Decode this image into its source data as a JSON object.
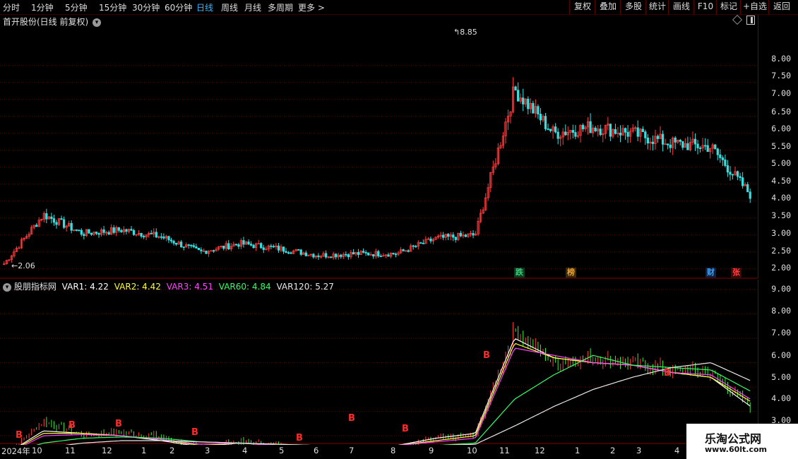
{
  "toolbar": {
    "periods": [
      "分时",
      "1分钟",
      "5分钟",
      "15分钟",
      "30分钟",
      "60分钟",
      "日线",
      "周线",
      "月线",
      "多周期",
      "更多 >"
    ],
    "active_period": "日线",
    "buttons": [
      "复权",
      "叠加",
      "多股",
      "统计",
      "画线",
      "F10",
      "标记",
      "+自选",
      "返回"
    ]
  },
  "main_chart": {
    "title": "首开股份(日线 前复权)",
    "high_label": "8.85",
    "low_label": "2.06",
    "y_ticks": [
      "8.00",
      "7.50",
      "7.00",
      "6.50",
      "6.00",
      "5.50",
      "5.00",
      "4.50",
      "4.00",
      "3.50",
      "3.00",
      "2.50",
      "2.00"
    ],
    "tags": [
      {
        "text": "跌",
        "color": "#33d17a"
      },
      {
        "text": "榜",
        "color": "#f0a030"
      },
      {
        "text": "财",
        "color": "#3ba0ff"
      },
      {
        "text": "张",
        "color": "#ff4040"
      }
    ]
  },
  "indicator": {
    "name": "股朋指标网",
    "items": [
      {
        "label": "VAR1: 4.22",
        "color": "#ffffff"
      },
      {
        "label": "VAR2: 4.42",
        "color": "#ffff33"
      },
      {
        "label": "VAR3: 4.51",
        "color": "#ff44ff"
      },
      {
        "label": "VAR60: 4.84",
        "color": "#33ff66"
      },
      {
        "label": "VAR120: 5.27",
        "color": "#e8e8e8"
      }
    ],
    "y_ticks": [
      "9.00",
      "8.00",
      "7.00",
      "6.00",
      "5.00",
      "4.00",
      "3.00"
    ],
    "signal_text": "B"
  },
  "x_axis": [
    "2024年",
    "10",
    "11",
    "12",
    "1",
    "2",
    "3",
    "4",
    "5",
    "6",
    "7",
    "8",
    "9",
    "10",
    "11",
    "12",
    "1",
    "2",
    "3",
    "4"
  ],
  "watermark": {
    "title": "乐淘公式网",
    "url": "www.60lt.com"
  },
  "colors": {
    "up": "#ff3b3b",
    "down": "#33e0e0",
    "grid": "#5a0000",
    "border": "#8a0000",
    "active": "#33b5ff"
  },
  "chart_data": [
    {
      "type": "candlestick",
      "title": "首开股份(日线 前复权)",
      "ylim": [
        1.85,
        9.1
      ],
      "x": [
        "2024-09",
        "2024-10",
        "2024-11",
        "2024-12",
        "2025-01",
        "2025-02",
        "2025-03",
        "2025-04",
        "2025-05",
        "2025-06",
        "2025-07",
        "2025-08",
        "2025-09",
        "2025-10",
        "2025-11",
        "2025-12",
        "2026-01",
        "2026-02",
        "2026-03",
        "2026-04"
      ],
      "series": [
        {
          "values": [
            2.15,
            3.6,
            3.05,
            3.15,
            2.95,
            2.5,
            2.75,
            2.6,
            2.4,
            2.45,
            2.45,
            2.9,
            3.0,
            7.3,
            6.0,
            6.2,
            6.0,
            5.7,
            5.6,
            4.2
          ]
        }
      ],
      "annotations": [
        {
          "text": "8.85",
          "y": 8.85
        },
        {
          "text": "2.06",
          "y": 2.06
        }
      ]
    },
    {
      "type": "line",
      "ylim": [
        2.8,
        9.35
      ],
      "x": [
        "2024-09",
        "2024-10",
        "2024-11",
        "2024-12",
        "2025-01",
        "2025-02",
        "2025-03",
        "2025-04",
        "2025-05",
        "2025-06",
        "2025-07",
        "2025-08",
        "2025-09",
        "2025-10",
        "2025-11",
        "2025-12",
        "2026-01",
        "2026-02",
        "2026-03",
        "2026-04"
      ],
      "series": [
        {
          "name": "VAR1",
          "values": [
            2.2,
            3.2,
            3.1,
            3.0,
            2.8,
            2.55,
            2.7,
            2.6,
            2.5,
            2.5,
            2.6,
            2.9,
            3.1,
            7.0,
            6.2,
            6.0,
            5.9,
            5.6,
            5.4,
            4.22
          ]
        },
        {
          "name": "VAR2",
          "values": [
            2.2,
            3.1,
            3.1,
            3.0,
            2.85,
            2.6,
            2.7,
            2.6,
            2.5,
            2.5,
            2.6,
            2.8,
            3.0,
            6.8,
            6.2,
            6.0,
            5.9,
            5.6,
            5.4,
            4.42
          ]
        },
        {
          "name": "VAR3",
          "values": [
            2.2,
            3.0,
            3.05,
            3.0,
            2.85,
            2.65,
            2.7,
            2.6,
            2.55,
            2.5,
            2.6,
            2.75,
            2.9,
            6.6,
            6.3,
            6.0,
            5.9,
            5.6,
            5.5,
            4.51
          ]
        },
        {
          "name": "VAR60",
          "values": [
            2.2,
            2.7,
            2.9,
            2.95,
            2.9,
            2.75,
            2.7,
            2.65,
            2.6,
            2.55,
            2.55,
            2.6,
            2.7,
            4.5,
            5.5,
            6.3,
            5.9,
            5.8,
            5.7,
            4.84
          ]
        },
        {
          "name": "VAR120",
          "values": [
            2.2,
            2.5,
            2.7,
            2.8,
            2.8,
            2.75,
            2.7,
            2.65,
            2.6,
            2.6,
            2.55,
            2.6,
            2.65,
            3.4,
            4.2,
            4.9,
            5.4,
            5.8,
            6.0,
            5.27
          ]
        }
      ],
      "annotations": [
        {
          "text": "B"
        }
      ]
    }
  ]
}
